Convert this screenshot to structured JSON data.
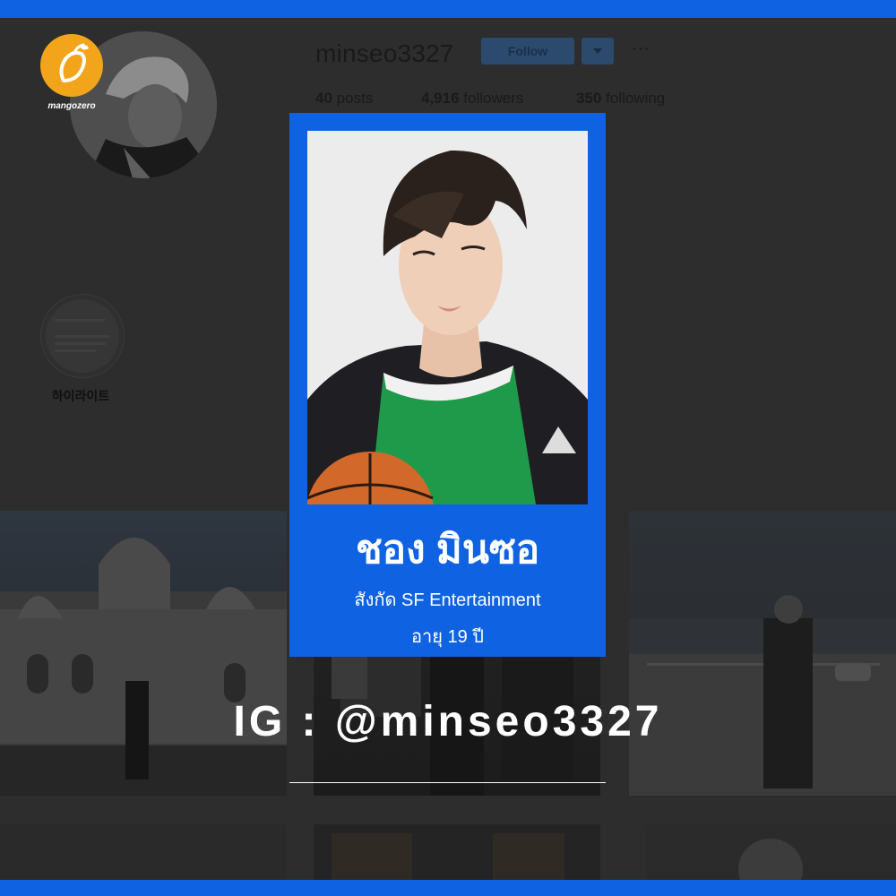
{
  "profile": {
    "username": "minseo3327",
    "follow_label": "Follow",
    "more_label": "···",
    "stats": {
      "posts_count": "40",
      "posts_label": "posts",
      "followers_count": "4,916",
      "followers_label": "followers",
      "following_count": "350",
      "following_label": "following"
    }
  },
  "highlight": {
    "label": "하이라이트"
  },
  "logo": {
    "text": "mangozero"
  },
  "card": {
    "name": "ชอง มินซอ",
    "agency": "สังกัด SF Entertainment",
    "age": "อายุ 19 ปี"
  },
  "instagram_handle": "IG : @minseo3327",
  "colors": {
    "brand_blue": "#0f63e2",
    "mango_orange": "#f2a51a",
    "jersey_green": "#1f9a4a"
  }
}
